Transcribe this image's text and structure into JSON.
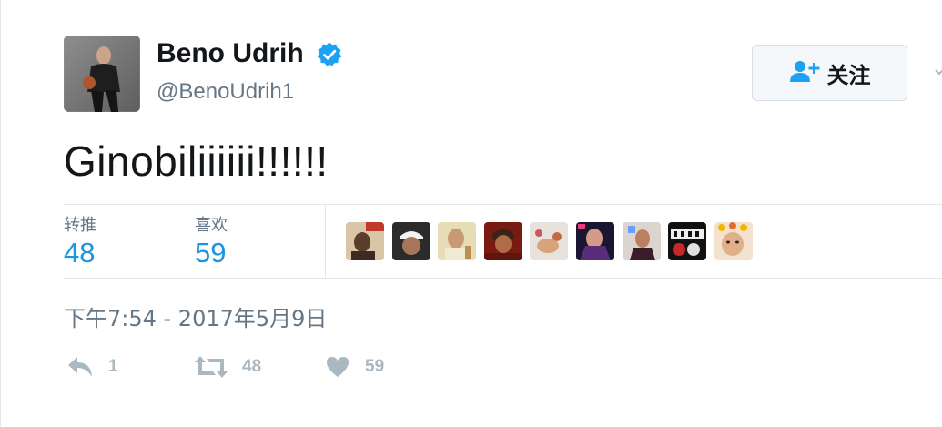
{
  "author": {
    "display_name": "Beno Udrih",
    "handle": "@BenoUdrih1",
    "verified": true
  },
  "follow_button": {
    "label": "关注",
    "icon": "add-user-icon"
  },
  "tweet": {
    "text": "Ginobiliiiiii!!!!!!"
  },
  "stats": {
    "retweets_label": "转推",
    "retweets_value": "48",
    "likes_label": "喜欢",
    "likes_value": "59"
  },
  "timestamp": "下午7:54 - 2017年5月9日",
  "actions": {
    "reply_count": "1",
    "retweet_count": "48",
    "like_count": "59"
  },
  "colors": {
    "link_blue": "#1b95e0",
    "verified_blue": "#1da1f2",
    "text": "#14171a",
    "muted": "#657786",
    "icon_muted": "#aab8c2",
    "border": "#e1e8ed"
  }
}
